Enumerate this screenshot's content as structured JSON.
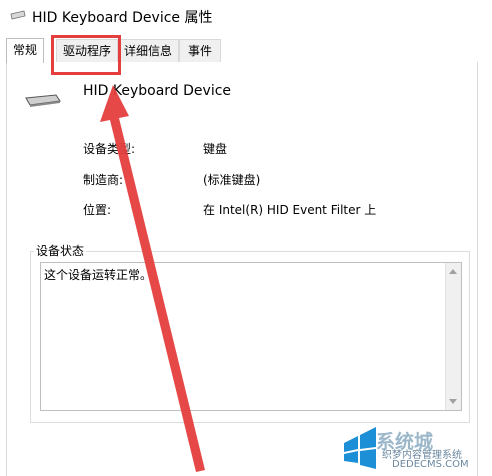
{
  "window": {
    "title": "HID Keyboard Device 属性"
  },
  "tabs": [
    {
      "label": "常规",
      "active": true
    },
    {
      "label": "驱动程序",
      "active": false
    },
    {
      "label": "详细信息",
      "active": false
    },
    {
      "label": "事件",
      "active": false
    }
  ],
  "device": {
    "name": "HID Keyboard Device",
    "icon": "keyboard-icon"
  },
  "properties": [
    {
      "label": "设备类型:",
      "value": "键盘"
    },
    {
      "label": "制造商:",
      "value": "(标准键盘)"
    },
    {
      "label": "位置:",
      "value": "在 Intel(R) HID Event Filter 上"
    }
  ],
  "status": {
    "group_label": "设备状态",
    "text": "这个设备运转正常。"
  },
  "annotation": {
    "highlight_color": "#e53e3e"
  },
  "watermark": {
    "brand": "系统城",
    "site": "织梦内容管理系统",
    "url": "DEDECMS.COM"
  }
}
